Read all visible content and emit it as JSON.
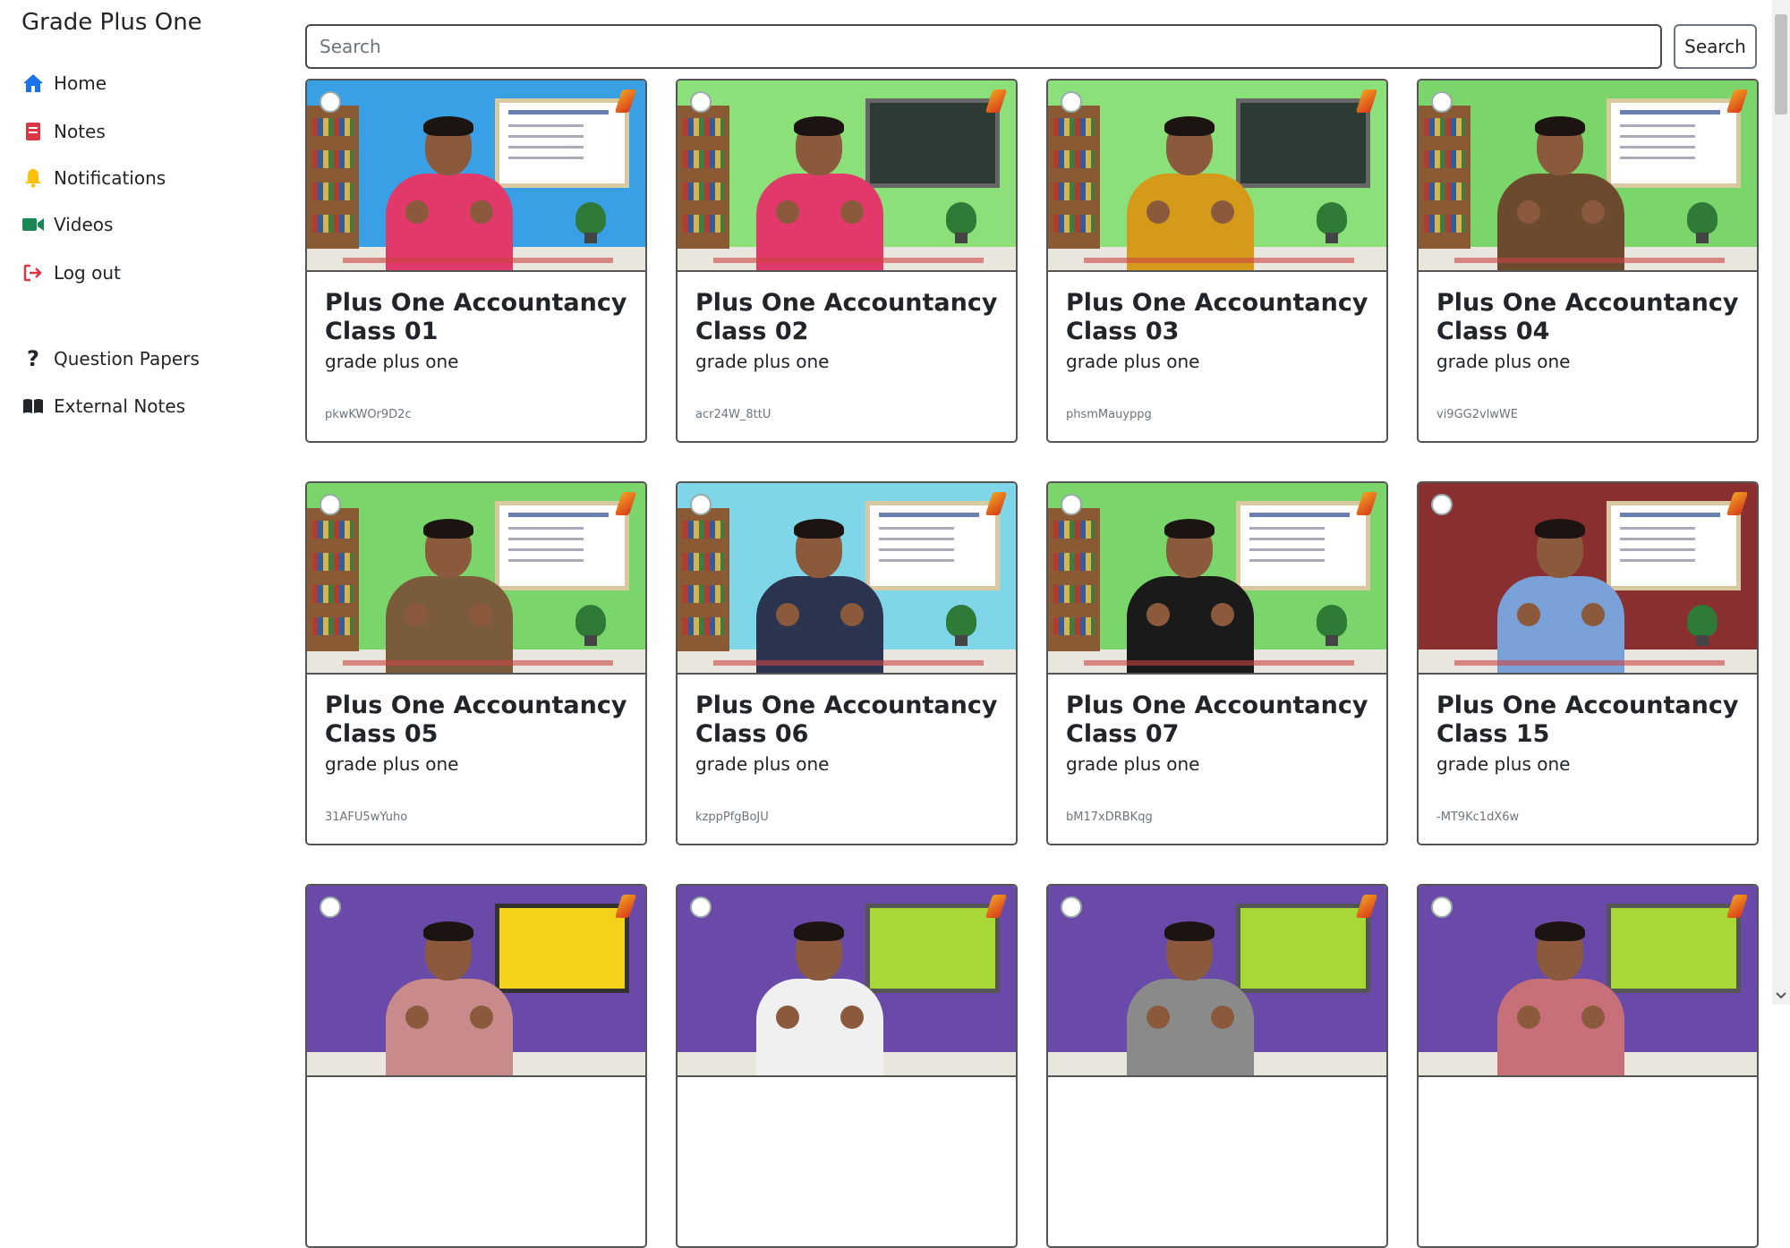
{
  "sidebar": {
    "brand": "Grade Plus One",
    "nav": [
      {
        "label": "Home",
        "icon": "home-icon"
      },
      {
        "label": "Notes",
        "icon": "notes-icon"
      },
      {
        "label": "Notifications",
        "icon": "bell-icon"
      },
      {
        "label": "Videos",
        "icon": "video-icon"
      },
      {
        "label": "Log out",
        "icon": "logout-icon"
      }
    ],
    "extra": [
      {
        "label": "Question Papers",
        "icon": "question-icon"
      },
      {
        "label": "External Notes",
        "icon": "book-icon"
      }
    ]
  },
  "search": {
    "placeholder": "Search",
    "button_label": "Search"
  },
  "colors": {
    "home": "#1a73e8",
    "notes": "#dc3545",
    "notifications": "#ffc107",
    "videos": "#198754",
    "logout": "#dc3545"
  },
  "videos": [
    {
      "title": "Plus One Accountancy Class 01",
      "subtitle": "grade plus one",
      "video_id": "pkwKWOr9D2c"
    },
    {
      "title": "Plus One Accountancy Class 02",
      "subtitle": "grade plus one",
      "video_id": "acr24W_8ttU"
    },
    {
      "title": "Plus One Accountancy Class 03",
      "subtitle": "grade plus one",
      "video_id": "phsmMauyppg"
    },
    {
      "title": "Plus One Accountancy Class 04",
      "subtitle": "grade plus one",
      "video_id": "vi9GG2vlwWE"
    },
    {
      "title": "Plus One Accountancy Class 05",
      "subtitle": "grade plus one",
      "video_id": "31AFU5wYuho"
    },
    {
      "title": "Plus One Accountancy Class 06",
      "subtitle": "grade plus one",
      "video_id": "kzppPfgBoJU"
    },
    {
      "title": "Plus One Accountancy Class 07",
      "subtitle": "grade plus one",
      "video_id": "bM17xDRBKqg"
    },
    {
      "title": "Plus One Accountancy Class 15",
      "subtitle": "grade plus one",
      "video_id": "-MT9Kc1dX6w"
    },
    {
      "title": "",
      "subtitle": "",
      "video_id": ""
    },
    {
      "title": "",
      "subtitle": "",
      "video_id": ""
    },
    {
      "title": "",
      "subtitle": "",
      "video_id": ""
    },
    {
      "title": "",
      "subtitle": "",
      "video_id": ""
    }
  ]
}
